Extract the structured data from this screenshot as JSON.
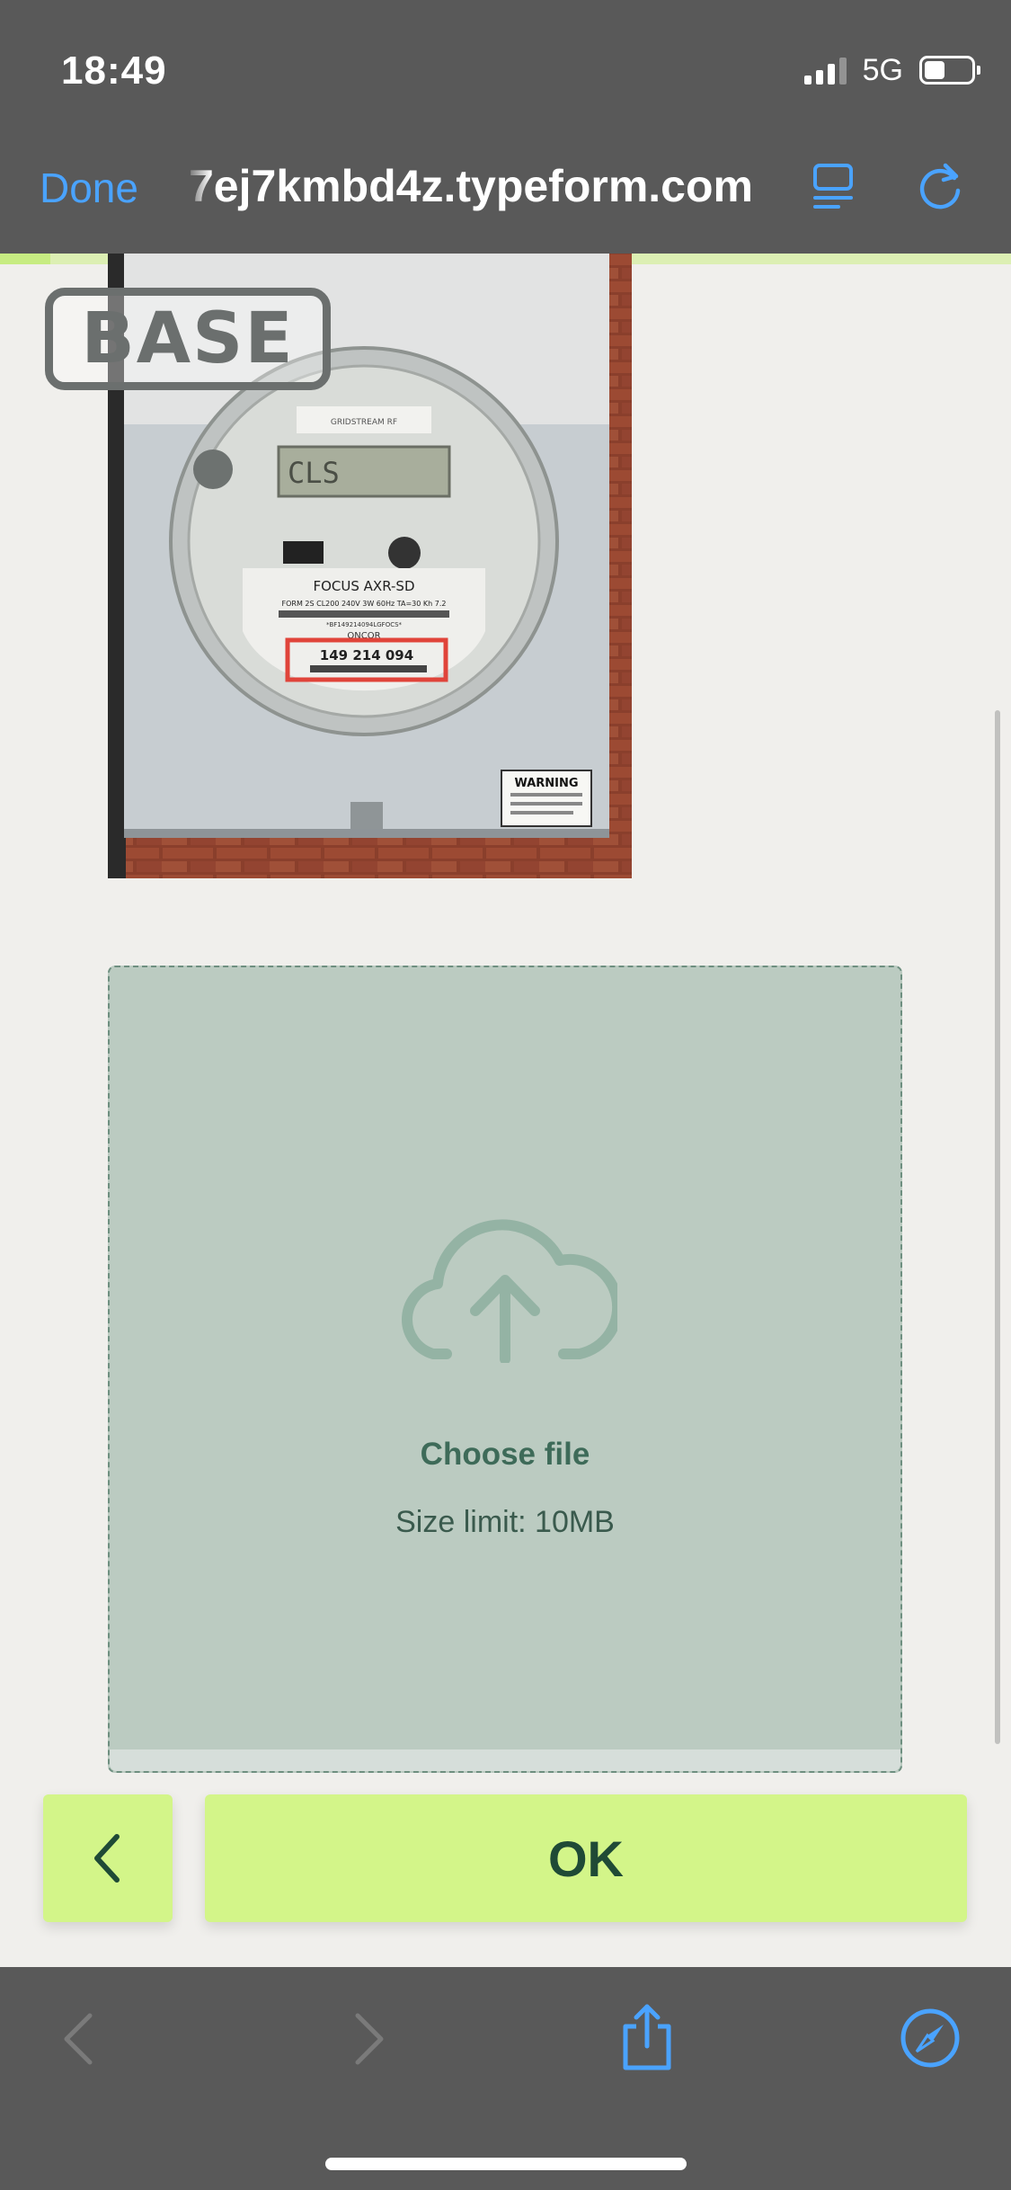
{
  "status": {
    "time": "18:49",
    "network": "5G",
    "signal_bars": 3,
    "battery_level": 0.4
  },
  "browser": {
    "done_label": "Done",
    "url": "7ej7kmbd4z.typeform.com",
    "accent_color": "#4aa3ff"
  },
  "form": {
    "progress": 0.05,
    "logo_text": "BASE",
    "upload": {
      "choose_label": "Choose file",
      "size_limit": "Size limit: 10MB"
    },
    "ok_label": "OK",
    "accent_color": "#d3f589"
  },
  "meter": {
    "brand": "FOCUS AXR-SD",
    "spec": "FORM 2S CL200 240V 3W 60Hz TA=30 Kh 7.2",
    "barcode": "*BF149214094LGFOCS*",
    "utility": "ONCOR",
    "meter_number": "149 214 094",
    "display": "CLS",
    "warning": "WARNING"
  }
}
